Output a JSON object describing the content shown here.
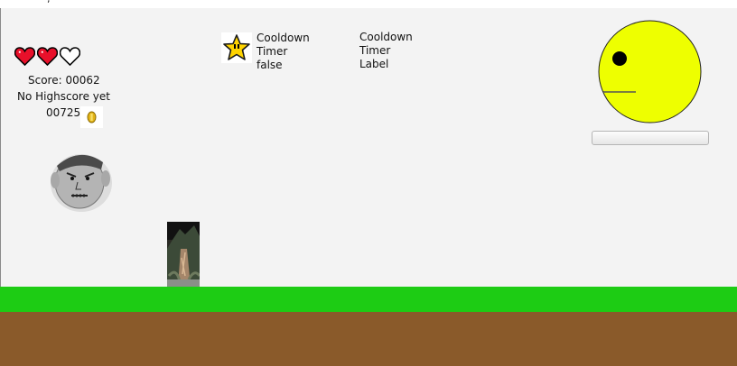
{
  "window": {
    "title_glyph": ","
  },
  "hud": {
    "hearts": [
      "full",
      "full",
      "empty"
    ],
    "score_text": "Score: 00062",
    "highscore_text": "No Highscore yet",
    "coins_text": "00725",
    "coin_icon": "coin-icon",
    "star_icon": "star-icon"
  },
  "cooldown_panel": {
    "line1": "Cooldown",
    "line2": "Timer",
    "line3": "false"
  },
  "cooldown_label": {
    "line1": "Cooldown",
    "line2": "Timer",
    "line3": "Label"
  },
  "progress": {
    "value": 0
  },
  "colors": {
    "grass": "#1dcc14",
    "dirt": "#8a5a2a",
    "sky": "#f3f3f3",
    "sun": "#eeff00",
    "heart": "#e8102a"
  }
}
